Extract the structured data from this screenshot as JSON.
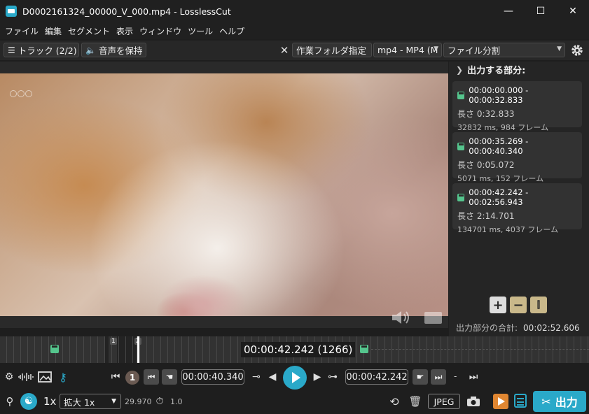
{
  "window": {
    "title": "D0002161324_00000_V_000.mp4 - LosslessCut",
    "min": "—",
    "max": "☐",
    "close": "✕"
  },
  "menu": [
    "ファイル",
    "編集",
    "セグメント",
    "表示",
    "ウィンドウ",
    "ツール",
    "ヘルプ"
  ],
  "toolbar": {
    "tracks": "トラック (2/2)",
    "keep_audio": "音声を保持",
    "working_dir": "作業フォルダ指定",
    "format": "mp4 - MP4 (M",
    "mode": "ファイル分割"
  },
  "segments_panel": {
    "header": "出力する部分:",
    "segments": [
      {
        "range": "00:00:00.000 - 00:00:32.833",
        "length": "長さ 0:32.833",
        "frames": "32832 ms, 984 フレーム"
      },
      {
        "range": "00:00:35.269 - 00:00:40.340",
        "length": "長さ 0:05.072",
        "frames": "5071 ms, 152 フレーム"
      },
      {
        "range": "00:00:42.242 - 00:02:56.943",
        "length": "長さ 2:14.701",
        "frames": "134701 ms, 4037 フレーム"
      }
    ],
    "total_label": "出力部分の合計:",
    "total_value": "00:02:52.606"
  },
  "timeline": {
    "current_time": "00:00:42.242 (1266)",
    "marker1": "1",
    "marker2": "2"
  },
  "controls": {
    "segment_number": "1",
    "cut_start": "00:00:40.340",
    "cut_end": "00:00:42.242",
    "dash": "-"
  },
  "bottom": {
    "speed": "1x",
    "zoom": "拡大 1x",
    "fps": "29.970",
    "rate": "1.0",
    "capture_format": "JPEG",
    "export": "出力"
  },
  "colors": {
    "accent": "#2aa9c9",
    "save_green": "#55c58d",
    "orange": "#e08631"
  }
}
